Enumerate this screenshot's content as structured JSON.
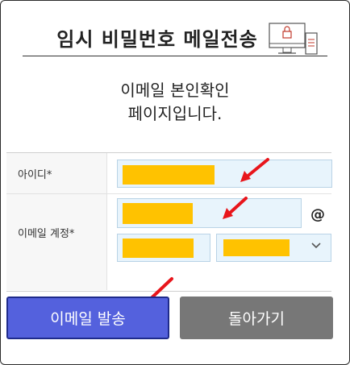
{
  "header": {
    "title": "임시 비밀번호 메일전송"
  },
  "message": {
    "line1": "이메일 본인확인",
    "line2": "페이지입니다."
  },
  "form": {
    "id_label": "아이디*",
    "email_label": "이메일 계정*",
    "at_symbol": "@"
  },
  "buttons": {
    "send_label": "이메일 발송",
    "back_label": "돌아가기"
  },
  "colors": {
    "primary": "#5461dd",
    "secondary": "#777777",
    "mask": "#ffc200",
    "arrow": "#e8151b"
  },
  "icons": [
    "computer-lock-icon",
    "chevron-down-icon",
    "red-arrow-icon"
  ]
}
